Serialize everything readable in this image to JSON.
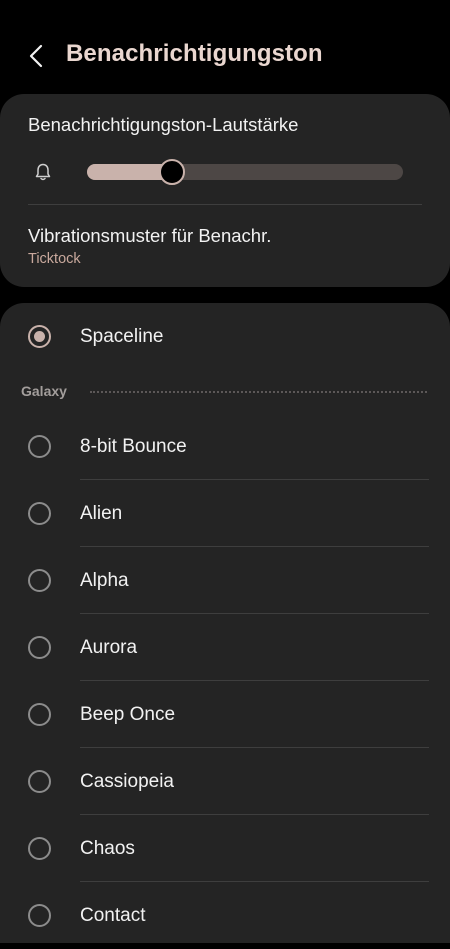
{
  "header": {
    "title": "Benachrichtigungston",
    "back_icon": "chevron-left-icon"
  },
  "volume": {
    "label": "Benachrichtigungston-Lautstärke",
    "icon": "bell-icon",
    "level_fraction": 0.27
  },
  "vibration": {
    "title": "Vibrationsmuster für Benachr.",
    "value": "Ticktock"
  },
  "current": {
    "label": "Spaceline",
    "selected": true
  },
  "section": {
    "label": "Galaxy"
  },
  "tones": [
    {
      "label": "8-bit Bounce",
      "selected": false
    },
    {
      "label": "Alien",
      "selected": false
    },
    {
      "label": "Alpha",
      "selected": false
    },
    {
      "label": "Aurora",
      "selected": false
    },
    {
      "label": "Beep Once",
      "selected": false
    },
    {
      "label": "Cassiopeia",
      "selected": false
    },
    {
      "label": "Chaos",
      "selected": false
    },
    {
      "label": "Contact",
      "selected": false
    }
  ],
  "colors": {
    "accent": "#c9b2ab",
    "title": "#ead7d0",
    "sub_accent": "#c9a99d",
    "card_bg": "#242424",
    "page_bg": "#000000"
  }
}
